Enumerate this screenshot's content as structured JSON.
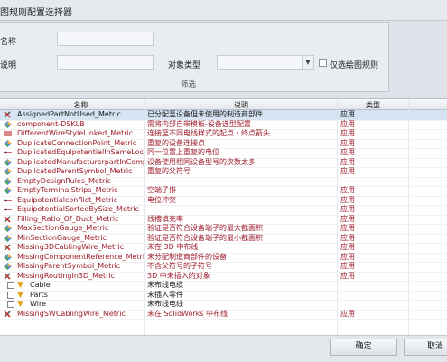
{
  "window": {
    "title": "图规则配置选择器"
  },
  "filter": {
    "name_label": "名称",
    "desc_label": "说明",
    "object_type_label": "对象类型",
    "only_selected_label": "仅选绘图规则",
    "section_title": "筛选"
  },
  "grid": {
    "headers": {
      "name": "名称",
      "desc": "说明",
      "type": "类型"
    },
    "rows": [
      {
        "icon": "wrench-icon",
        "name": "AssignedPartNotUsed_Metric",
        "desc": "已分配至设备但未使用的制造商部件",
        "type": "应用",
        "selected": true
      },
      {
        "icon": "diamond-icon",
        "name": "component-DSKLB",
        "desc": "需将内部自带模板-设备选型配置",
        "type": "应用"
      },
      {
        "icon": "lines-icon",
        "name": "DifferentWireStyleLinked_Metric",
        "desc": "连接至不同电线样式的起点・终点箭头",
        "type": "应用"
      },
      {
        "icon": "diamond-icon",
        "name": "DuplicateConnectionPoint_Metric",
        "desc": "重复的设备连接点",
        "type": "应用"
      },
      {
        "icon": "wire-icon",
        "name": "DuplicatedEquipotentialInSameLocatio…",
        "desc": "同一位置上重复的电位",
        "type": "应用"
      },
      {
        "icon": "diamond-icon",
        "name": "DuplicatedManufacturerpartInCompon…",
        "desc": "设备使用相同设备型号的次数太多",
        "type": "应用"
      },
      {
        "icon": "diamond-icon",
        "name": "DuplicatedParentSymbol_Metric",
        "desc": "重复的父符号",
        "type": "应用"
      },
      {
        "icon": "diamond-icon",
        "name": "EmptyDesignRules_Metric",
        "desc": "",
        "type": ""
      },
      {
        "icon": "diamond-icon",
        "name": "EmptyTerminalStrips_Metric",
        "desc": "空端子排",
        "type": "应用"
      },
      {
        "icon": "wire-icon",
        "name": "Equipotentialconflict_Metric",
        "desc": "电位冲突",
        "type": "应用"
      },
      {
        "icon": "wire-icon",
        "name": "EquipotentialSortedBySize_Metric",
        "desc": "",
        "type": "应用"
      },
      {
        "icon": "wrench-icon",
        "name": "Filling_Ratio_Of_Duct_Metric",
        "desc": "线槽填充率",
        "type": "应用"
      },
      {
        "icon": "diamond-icon",
        "name": "MaxSectionGauge_Metric",
        "desc": "验证是否符合设备端子的最大截面积",
        "type": "应用"
      },
      {
        "icon": "diamond-icon",
        "name": "MinSectionGauge_Metric",
        "desc": "验证是否符合设备端子的最小截面积",
        "type": "应用"
      },
      {
        "icon": "wrench-icon",
        "name": "Missing3DCablingWire_Metric",
        "desc": "未在 3D 中布线",
        "type": "应用"
      },
      {
        "icon": "diamond-icon",
        "name": "MissingComponentReference_Metric",
        "desc": "未分配制造商部件的设备",
        "type": "应用"
      },
      {
        "icon": "diamond-icon",
        "name": "MissingParentSymbol_Metric",
        "desc": "不含父符号的子符号",
        "type": "应用"
      },
      {
        "icon": "wrench-icon",
        "name": "MissingRoutingIn3D_Metric",
        "desc": "3D 中未插入的对象",
        "type": "应用"
      }
    ],
    "subrows": [
      {
        "label": "Cable",
        "desc": "未布线电缆"
      },
      {
        "label": "Parts",
        "desc": "未插入零件"
      },
      {
        "label": "Wire",
        "desc": "未布线电线"
      }
    ],
    "partial_row": {
      "name": "MissingSWCablingWire_Metric",
      "desc": "未在 SolidWorks 中布线",
      "type": "应用"
    }
  },
  "footer": {
    "ok_label": "确定",
    "cancel_label": "取消"
  }
}
